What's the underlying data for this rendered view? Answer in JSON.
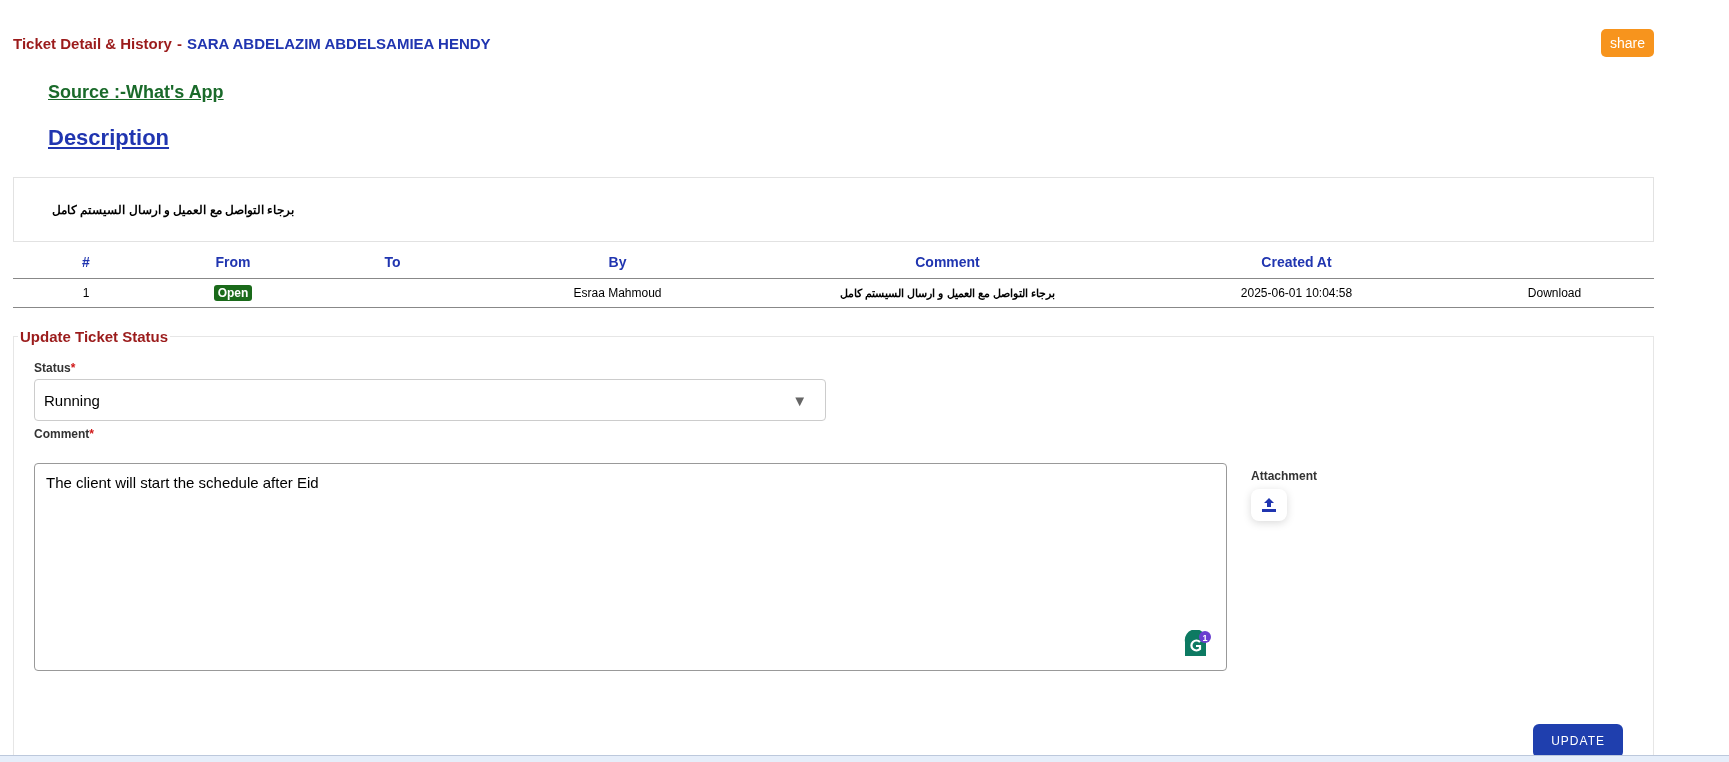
{
  "header": {
    "title": "Ticket Detail & History",
    "separator": "-",
    "customer": "SARA ABDELAZIM ABDELSAMIEA HENDY",
    "share_button": "share"
  },
  "source": "Source :-What's App",
  "description": {
    "heading": "Description",
    "text": "برجاء التواصل مع العميل و ارسال السيستم كامل"
  },
  "history": {
    "columns": [
      "#",
      "From",
      "To",
      "By",
      "Comment",
      "Created At"
    ],
    "rows": [
      {
        "number": "1",
        "from": "Open",
        "to": "",
        "by": "Esraa Mahmoud",
        "comment": "برجاء التواصل مع العميل و ارسال السيستم كامل",
        "created_at": "2025-06-01 10:04:58",
        "action": "Download"
      }
    ]
  },
  "update_form": {
    "legend": "Update Ticket Status",
    "status_label": "Status",
    "required_mark": "*",
    "status_value": "Running",
    "dropdown_arrow": "▼",
    "comment_label": "Comment",
    "comment_value": "The client will start the schedule after Eid",
    "grammar_badge": "1",
    "attachment_label": "Attachment",
    "submit_button": "UPDATE"
  }
}
